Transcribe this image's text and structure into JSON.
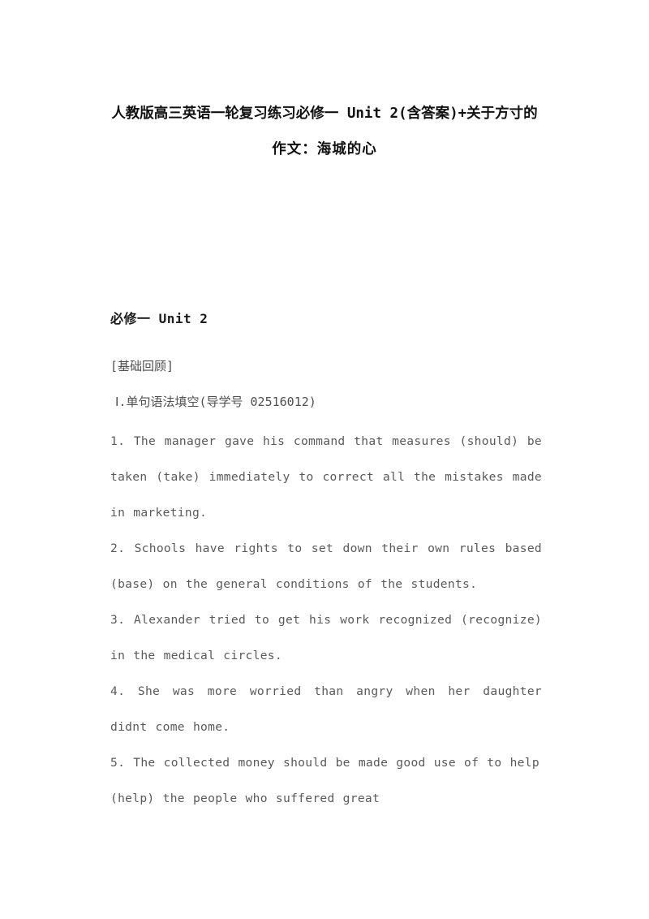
{
  "document": {
    "title_lines": [
      "人教版高三英语一轮复习练习必修一 Unit 2(含答案)+关于方寸的",
      "作文：海城的心"
    ],
    "section_heading": "必修一 Unit 2",
    "bracket_label": "[基础回顾]",
    "sub_heading": "Ⅰ.单句语法填空(导学号 02516012)",
    "exercise_number": "02516012",
    "questions": [
      {
        "number": "1.",
        "text": "1. The manager gave his command that measures   (should) be taken  (take) immediately to correct all the mistakes made in marketing.",
        "answer": "should be taken",
        "prompt": "(take)"
      },
      {
        "number": "2.",
        "text": "2. Schools have rights to set down their own rules based   (base) on the general conditions of the students.",
        "answer": "based",
        "prompt": "(base)"
      },
      {
        "number": "3.",
        "text": "3. Alexander tried to get his work   recognized  (recognize) in the medical circles.",
        "answer": "recognized",
        "prompt": "(recognize)"
      },
      {
        "number": "4.",
        "text": "4. She was   more   worried than angry when her daughter didnt come home.",
        "answer": "more",
        "prompt": ""
      },
      {
        "number": "5.",
        "text": "5. The collected money should be made good use of   to help   (help)  the  people  who  suffered  great",
        "answer": "to help",
        "prompt": "(help)"
      }
    ]
  },
  "colors": {
    "page_background": "#ffffff",
    "title_text": "#111111",
    "heading_text": "#1a1a1a",
    "body_text": "#5a5a5a",
    "label_text": "#4f4f4f"
  }
}
